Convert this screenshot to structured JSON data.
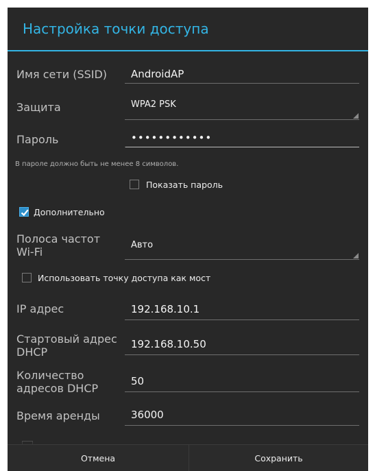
{
  "dialog": {
    "title": "Настройка точки доступа",
    "ssid": {
      "label": "Имя сети (SSID)",
      "value": "AndroidAP"
    },
    "security": {
      "label": "Защита",
      "value": "WPA2 PSK"
    },
    "password": {
      "label": "Пароль",
      "value": "••••••••••••",
      "hint": "В пароле должно быть не менее 8 символов.",
      "show_label": "Показать пароль",
      "show_checked": false
    },
    "advanced": {
      "label": "Дополнительно",
      "checked": true
    },
    "band": {
      "label_line1": "Полоса частот",
      "label_line2": "Wi-Fi",
      "value": "Авто"
    },
    "bridge": {
      "label": "Использовать точку доступа как мост",
      "checked": false
    },
    "ip": {
      "label": "IP адрес",
      "value": "192.168.10.1"
    },
    "dhcp_start": {
      "label_line1": "Стартовый адрес",
      "label_line2": "DHCP",
      "value": "192.168.10.50"
    },
    "dhcp_count": {
      "label_line1": "Количество",
      "label_line2": "адресов DHCP",
      "value": "50"
    },
    "lease": {
      "label": "Время аренды",
      "value": "36000"
    }
  },
  "buttons": {
    "cancel": "Отмена",
    "save": "Сохранить"
  },
  "colors": {
    "accent": "#33b5e5",
    "background": "#282828",
    "checkbox_checked": "#2c8ec9"
  }
}
